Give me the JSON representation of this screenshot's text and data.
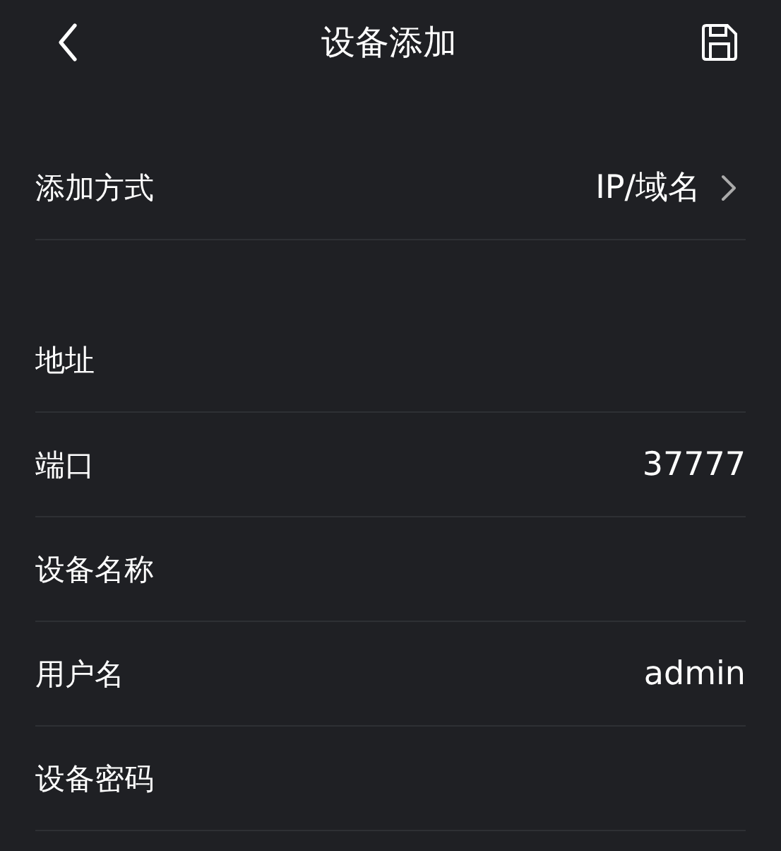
{
  "header": {
    "title": "设备添加"
  },
  "sections": [
    {
      "rows": [
        {
          "kind": "select",
          "label": "添加方式",
          "value": "IP/域名"
        }
      ]
    },
    {
      "rows": [
        {
          "kind": "field",
          "label": "地址"
        },
        {
          "kind": "field",
          "label": "端口",
          "value": "37777"
        },
        {
          "kind": "field",
          "label": "设备名称"
        },
        {
          "kind": "field",
          "label": "用户名",
          "value": "admin"
        },
        {
          "kind": "field",
          "label": "设备密码"
        }
      ]
    }
  ]
}
